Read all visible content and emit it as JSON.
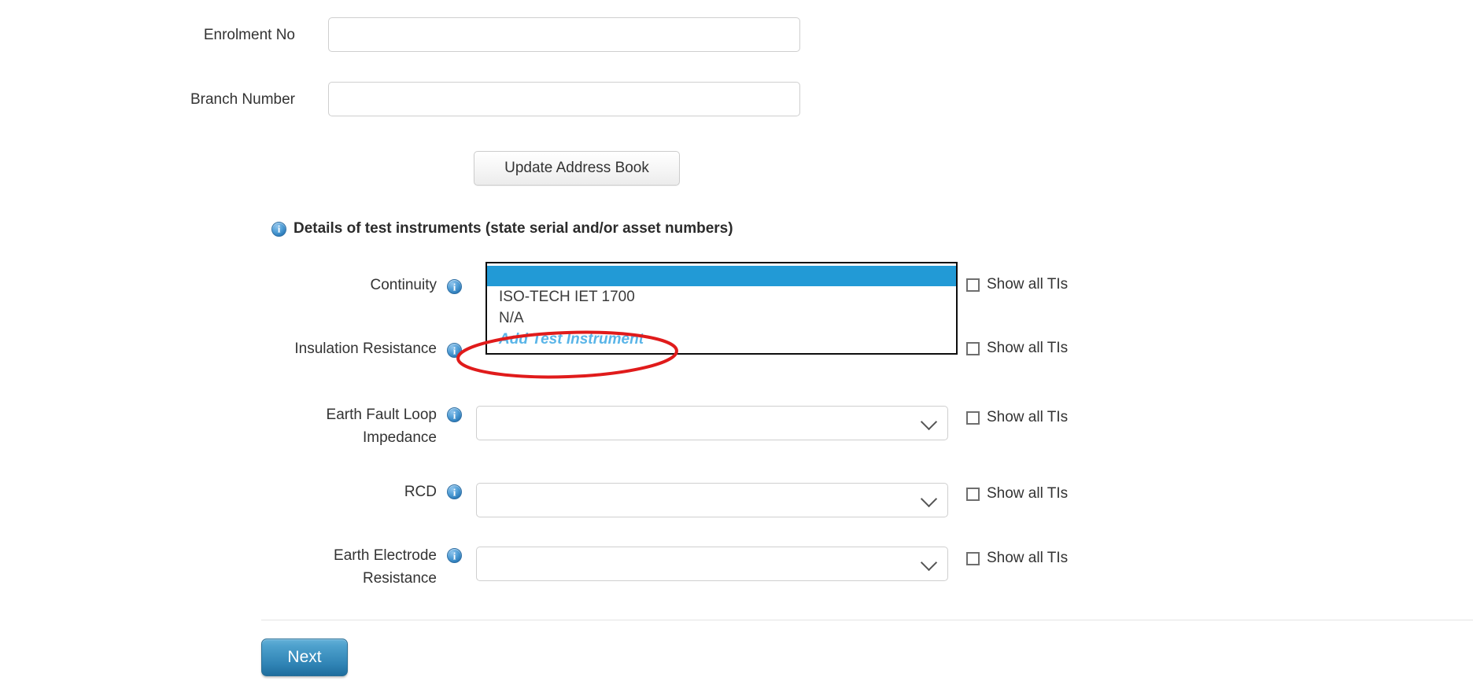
{
  "form": {
    "fields": [
      {
        "label": "Enrolment No",
        "value": "",
        "placeholder": ""
      },
      {
        "label": "Branch Number",
        "value": "",
        "placeholder": ""
      }
    ],
    "update_address_book_label": "Update Address Book"
  },
  "section": {
    "info_icon": "info-icon",
    "heading": "Details of test instruments (state serial and/or asset numbers)"
  },
  "instruments": [
    {
      "label": "Continuity",
      "info_icon": "info-icon",
      "state": "open",
      "value": "",
      "checkbox_label": "Show all TIs",
      "checked": false
    },
    {
      "label": "Insulation Resistance",
      "info_icon": "info-icon",
      "state": "hidden-behind-dropdown",
      "value": "",
      "checkbox_label": "Show all TIs",
      "checked": false
    },
    {
      "label": "Earth Fault Loop\nImpedance",
      "info_icon": "info-icon",
      "state": "closed",
      "value": "",
      "checkbox_label": "Show all TIs",
      "checked": false
    },
    {
      "label": "RCD",
      "info_icon": "info-icon",
      "state": "closed",
      "value": "",
      "checkbox_label": "Show all TIs",
      "checked": false
    },
    {
      "label": "Earth Electrode\nResistance",
      "info_icon": "info-icon",
      "state": "closed",
      "value": "",
      "checkbox_label": "Show all TIs",
      "checked": false
    }
  ],
  "dropdown": {
    "options": [
      {
        "label": "",
        "selected": true,
        "style": "blank"
      },
      {
        "label": "ISO-TECH IET 1700",
        "selected": false,
        "style": "normal"
      },
      {
        "label": "N/A",
        "selected": false,
        "style": "normal"
      },
      {
        "label": "Add Test Instrument",
        "selected": false,
        "style": "add"
      }
    ],
    "selected_value": ""
  },
  "annotation": {
    "shape": "ellipse",
    "color": "#e01b1b",
    "targets": "Add Test Instrument"
  },
  "footer": {
    "next_label": "Next"
  },
  "colors": {
    "highlight": "#229ad6",
    "link": "#5ab5e8",
    "annotation": "#e01b1b",
    "next_button": "#2f83b4"
  }
}
